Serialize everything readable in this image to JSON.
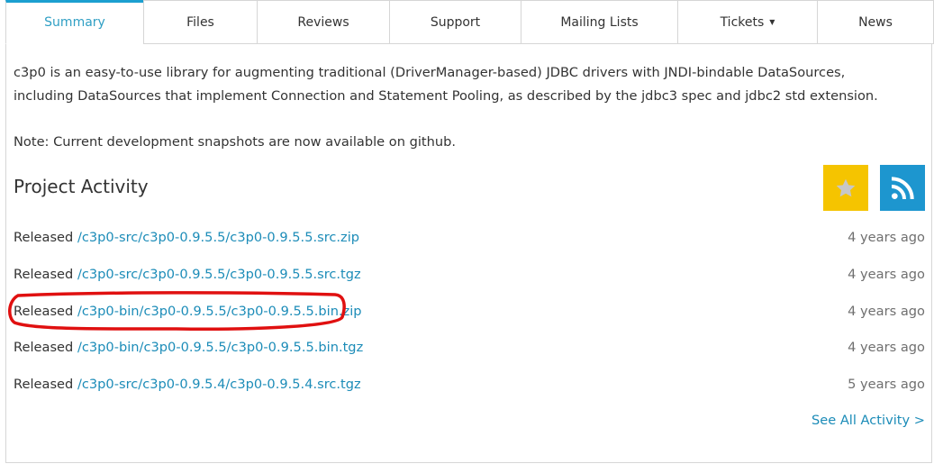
{
  "tabs": [
    {
      "label": "Summary",
      "active": true
    },
    {
      "label": "Files"
    },
    {
      "label": "Reviews"
    },
    {
      "label": "Support"
    },
    {
      "label": "Mailing Lists"
    },
    {
      "label": "Tickets",
      "dropdown": true
    },
    {
      "label": "News"
    }
  ],
  "description": "c3p0 is an easy-to-use library for augmenting traditional (DriverManager-based) JDBC drivers with JNDI-bindable DataSources, including DataSources that implement Connection and Statement Pooling, as described by the jdbc3 spec and jdbc2 std extension.",
  "note": "Note: Current development snapshots are now available on github.",
  "activity": {
    "title": "Project Activity",
    "items": [
      {
        "prefix": "Released",
        "path": "/c3p0-src/c3p0-0.9.5.5/c3p0-0.9.5.5.src.zip",
        "time": "4 years ago"
      },
      {
        "prefix": "Released",
        "path": "/c3p0-src/c3p0-0.9.5.5/c3p0-0.9.5.5.src.tgz",
        "time": "4 years ago"
      },
      {
        "prefix": "Released",
        "path": "/c3p0-bin/c3p0-0.9.5.5/c3p0-0.9.5.5.bin.zip",
        "time": "4 years ago",
        "highlighted": true
      },
      {
        "prefix": "Released",
        "path": "/c3p0-bin/c3p0-0.9.5.5/c3p0-0.9.5.5.bin.tgz",
        "time": "4 years ago"
      },
      {
        "prefix": "Released",
        "path": "/c3p0-src/c3p0-0.9.5.4/c3p0-0.9.5.4.src.tgz",
        "time": "5 years ago"
      }
    ],
    "see_all": "See All Activity >"
  },
  "icons": {
    "star_button": "star-icon",
    "rss_button": "rss-icon"
  },
  "colors": {
    "accent": "#1c9fd0",
    "link": "#1c8cb8",
    "star_bg": "#f5c400",
    "rss_bg": "#1d96cf",
    "highlight_stroke": "#e01010"
  }
}
